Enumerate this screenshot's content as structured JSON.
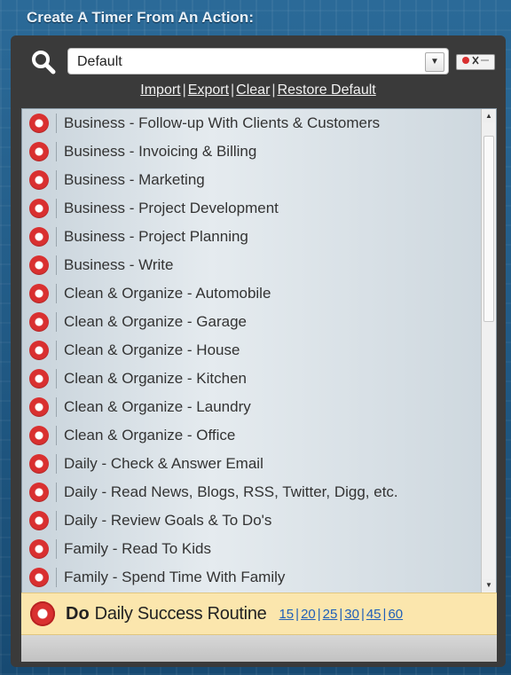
{
  "header": {
    "title": "Create A Timer From An Action:"
  },
  "toolbar": {
    "search_icon": "search-icon",
    "dropdown_value": "Default",
    "dropdown_arrow": "▼",
    "links": [
      "Import",
      "Export",
      "Clear",
      "Restore Default"
    ],
    "link_separator": "|"
  },
  "actions": [
    "Business - Follow-up With Clients & Customers",
    "Business - Invoicing & Billing",
    "Business - Marketing",
    "Business - Project Development",
    "Business - Project Planning",
    "Business - Write",
    "Clean & Organize - Automobile",
    "Clean & Organize - Garage",
    "Clean & Organize - House",
    "Clean & Organize - Kitchen",
    "Clean & Organize - Laundry",
    "Clean & Organize - Office",
    "Daily - Check & Answer Email",
    "Daily - Read News, Blogs, RSS, Twitter, Digg, etc.",
    "Daily - Review Goals & To Do's",
    "Family - Read To Kids",
    "Family - Spend Time With Family"
  ],
  "scrollbar": {
    "up": "▲",
    "down": "▼"
  },
  "routine": {
    "prefix": "Do",
    "label": "Daily Success Routine",
    "minutes": [
      "15",
      "20",
      "25",
      "30",
      "45",
      "60"
    ],
    "separator": "|"
  },
  "colors": {
    "accent_red": "#d93030",
    "link_blue": "#1f5fb8",
    "routine_bg": "#fbe6ad"
  }
}
